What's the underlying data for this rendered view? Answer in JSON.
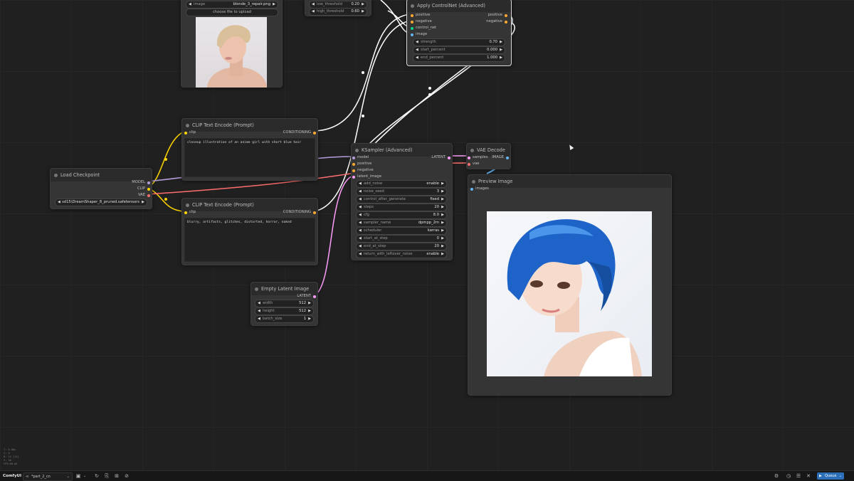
{
  "colors": {
    "clip": "#ffd500",
    "model": "#b39ddb",
    "vae": "#ff6e6e",
    "conditioning": "#ffa931",
    "latent": "#ff9cf9",
    "image": "#64b5f6",
    "control_net": "#00d78d",
    "link_white": "#ffffff"
  },
  "nodes": {
    "load_image": {
      "image_label": "image",
      "image_value": "blonde_3_repair.png",
      "upload_label": "choose file to upload"
    },
    "canny": {
      "low_label": "low_threshold",
      "low_value": "0.20",
      "high_label": "high_threshold",
      "high_value": "0.60"
    },
    "controlnet": {
      "title": "Apply ControlNet (Advanced)",
      "in_positive": "positive",
      "in_negative": "negative",
      "in_control_net": "control_net",
      "in_image": "image",
      "out_positive": "positive",
      "out_negative": "negative",
      "widgets": [
        {
          "label": "strength",
          "value": "0.70"
        },
        {
          "label": "start_percent",
          "value": "0.000"
        },
        {
          "label": "end_percent",
          "value": "1.000"
        }
      ]
    },
    "clip_pos": {
      "title": "CLIP Text Encode (Prompt)",
      "in_clip": "clip",
      "out": "CONDITIONING",
      "text": "closeup illustration of an anime girl with short blue hair"
    },
    "clip_neg": {
      "title": "CLIP Text Encode (Prompt)",
      "in_clip": "clip",
      "out": "CONDITIONING",
      "text": "blurry, artifacts, glitches, distorted, horror, naked"
    },
    "checkpoint": {
      "title": "Load Checkpoint",
      "out_model": "MODEL",
      "out_clip": "CLIP",
      "out_vae": "VAE",
      "ckpt": "sd15\\DreamShaper_8_pruned.safetensors"
    },
    "latent": {
      "title": "Empty Latent Image",
      "out": "LATENT",
      "widgets": [
        {
          "label": "width",
          "value": "512"
        },
        {
          "label": "height",
          "value": "512"
        },
        {
          "label": "batch_size",
          "value": "1"
        }
      ]
    },
    "ksampler": {
      "title": "KSampler (Advanced)",
      "in_model": "model",
      "in_positive": "positive",
      "in_negative": "negative",
      "in_latent": "latent_image",
      "out": "LATENT",
      "widgets": [
        {
          "label": "add_noise",
          "value": "enable"
        },
        {
          "label": "noise_seed",
          "value": "3"
        },
        {
          "label": "control_after_generate",
          "value": "fixed"
        },
        {
          "label": "steps",
          "value": "20"
        },
        {
          "label": "cfg",
          "value": "8.0"
        },
        {
          "label": "sampler_name",
          "value": "dpmpp_2m"
        },
        {
          "label": "scheduler",
          "value": "karras"
        },
        {
          "label": "start_at_step",
          "value": "0"
        },
        {
          "label": "end_at_step",
          "value": "20"
        },
        {
          "label": "return_with_leftover_noise",
          "value": "enable"
        }
      ]
    },
    "vae_decode": {
      "title": "VAE Decode",
      "in_samples": "samples",
      "in_vae": "vae",
      "out": "IMAGE"
    },
    "preview": {
      "title": "Preview Image",
      "in_images": "images"
    }
  },
  "stats": [
    "T: 0.00s",
    "I: 0",
    "N: 12 [12]",
    "V: 30",
    "FPS:60.00"
  ],
  "taskbar": {
    "app": "ComfyUI",
    "workflow_tab": "*part_2_cn",
    "queue_label": "Queue"
  }
}
